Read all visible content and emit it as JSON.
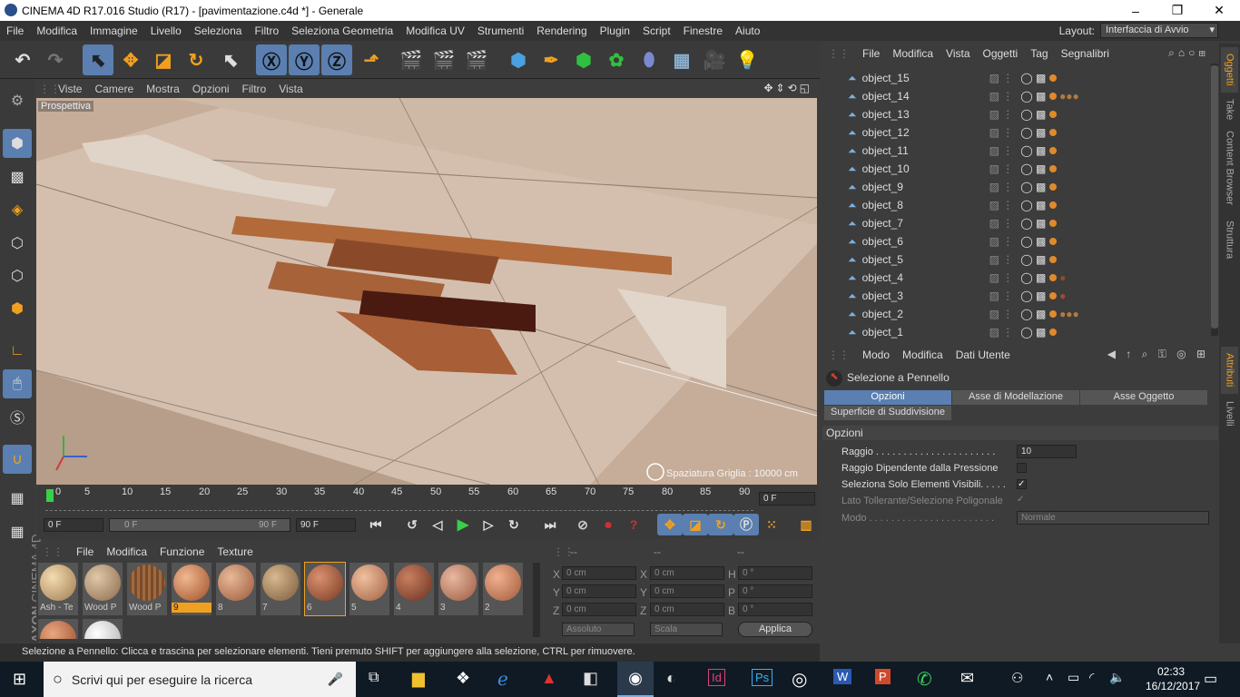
{
  "window": {
    "title": "CINEMA 4D R17.016 Studio (R17) - [pavimentazione.c4d *] - Generale",
    "min": "–",
    "max": "❐",
    "close": "✕"
  },
  "menubar": {
    "items": [
      "File",
      "Modifica",
      "Immagine",
      "Livello",
      "Seleziona",
      "Filtro",
      "Seleziona Geometria",
      "Modifica UV",
      "Strumenti",
      "Rendering",
      "Plugin",
      "Script",
      "Finestre",
      "Aiuto"
    ],
    "layout_label": "Layout:",
    "layout_value": "Interfaccia di Avvio"
  },
  "viewport": {
    "menu": [
      "Viste",
      "Camere",
      "Mostra",
      "Opzioni",
      "Filtro",
      "Vista"
    ],
    "label": "Prospettiva",
    "grid": "Spaziatura Griglia : 10000 cm"
  },
  "timeline": {
    "ticks": [
      "0",
      "5",
      "10",
      "15",
      "20",
      "25",
      "30",
      "35",
      "40",
      "45",
      "50",
      "55",
      "60",
      "65",
      "70",
      "75",
      "80",
      "85",
      "90"
    ],
    "frame_field": "0 F",
    "start": "0 F",
    "range_start": "0 F",
    "range_end": "90 F",
    "end": "90 F"
  },
  "materials": {
    "menu": [
      "File",
      "Modifica",
      "Funzione",
      "Texture"
    ],
    "items": [
      "Ash - Te",
      "Wood P",
      "Wood P",
      "9",
      "8",
      "7",
      "6",
      "5",
      "4",
      "3",
      "2"
    ]
  },
  "coords": {
    "headers": [
      "--",
      "--",
      "--"
    ],
    "rows": [
      [
        "X",
        "0 cm",
        "X",
        "0 cm",
        "H",
        "0 °"
      ],
      [
        "Y",
        "0 cm",
        "Y",
        "0 cm",
        "P",
        "0 °"
      ],
      [
        "Z",
        "0 cm",
        "Z",
        "0 cm",
        "B",
        "0 °"
      ]
    ],
    "mode1": "Assoluto",
    "mode2": "Scala",
    "apply": "Applica"
  },
  "status": "Selezione a Pennello: Clicca e trascina per selezionare elementi. Tieni premuto SHIFT per aggiungere alla selezione, CTRL per rimuovere.",
  "objects": {
    "menu": [
      "File",
      "Modifica",
      "Vista",
      "Oggetti",
      "Tag",
      "Segnalibri"
    ],
    "items": [
      "object_15",
      "object_14",
      "object_13",
      "object_12",
      "object_11",
      "object_10",
      "object_9",
      "object_8",
      "object_7",
      "object_6",
      "object_5",
      "object_4",
      "object_3",
      "object_2",
      "object_1"
    ]
  },
  "attributes": {
    "menu": [
      "Modo",
      "Modifica",
      "Dati Utente"
    ],
    "tool": "Selezione a Pennello",
    "tabs": [
      "Opzioni",
      "Asse di Modellazione",
      "Asse Oggetto"
    ],
    "tab2": "Superficie di Suddivisione",
    "section": "Opzioni",
    "raggio_label": "Raggio . . . . . . . . . . . . . . . . . . . . . .",
    "raggio_value": "10",
    "pressione": "Raggio Dipendente dalla Pressione",
    "visibili": "Seleziona Solo Elementi Visibili. . . . .",
    "tollerante": "Lato Tollerante/Selezione Poligonale",
    "modo_label": "Modo . . . . . . . . . . . . . . . . . . . . . . .",
    "modo_value": "Normale"
  },
  "right_tabs": [
    "Oggetti",
    "Take",
    "Content Browser",
    "Struttura"
  ],
  "right_tabs2": [
    "Attributi",
    "Livelli"
  ],
  "taskbar": {
    "search": "Scrivi qui per eseguire la ricerca",
    "time": "02:33",
    "date": "16/12/2017"
  },
  "brand": {
    "line1": "MAXON",
    "line2": "CINEMA 4D"
  }
}
